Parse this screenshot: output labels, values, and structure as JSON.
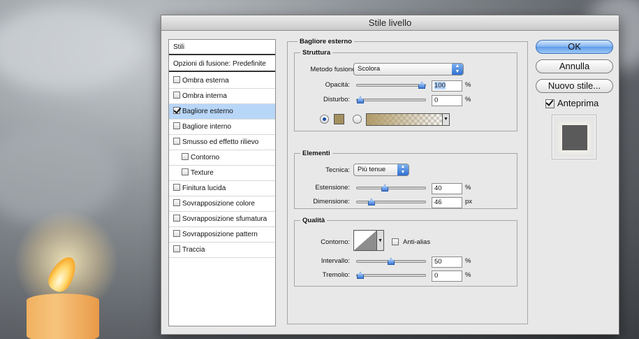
{
  "dialog": {
    "title": "Stile livello"
  },
  "styles_panel": {
    "header": "Stili",
    "blend_options": "Opzioni di fusione: Predefinite",
    "items": [
      {
        "label": "Ombra esterna",
        "checked": false,
        "indent": false,
        "selected": false
      },
      {
        "label": "Ombra interna",
        "checked": false,
        "indent": false,
        "selected": false
      },
      {
        "label": "Bagliore esterno",
        "checked": true,
        "indent": false,
        "selected": true
      },
      {
        "label": "Bagliore interno",
        "checked": false,
        "indent": false,
        "selected": false
      },
      {
        "label": "Smusso ed effetto rilievo",
        "checked": false,
        "indent": false,
        "selected": false
      },
      {
        "label": "Contorno",
        "checked": false,
        "indent": true,
        "selected": false
      },
      {
        "label": "Texture",
        "checked": false,
        "indent": true,
        "selected": false
      },
      {
        "label": "Finitura lucida",
        "checked": false,
        "indent": false,
        "selected": false
      },
      {
        "label": "Sovrapposizione colore",
        "checked": false,
        "indent": false,
        "selected": false
      },
      {
        "label": "Sovrapposizione sfumatura",
        "checked": false,
        "indent": false,
        "selected": false
      },
      {
        "label": "Sovrapposizione pattern",
        "checked": false,
        "indent": false,
        "selected": false
      },
      {
        "label": "Traccia",
        "checked": false,
        "indent": false,
        "selected": false
      }
    ]
  },
  "outer_glow": {
    "title": "Bagliore esterno",
    "structure": {
      "title": "Struttura",
      "blend_mode_label": "Metodo fusione:",
      "blend_mode_value": "Scolora",
      "opacity_label": "Opacità:",
      "opacity_value": "100",
      "opacity_unit": "%",
      "opacity_level": 1.0,
      "noise_label": "Disturbo:",
      "noise_value": "0",
      "noise_unit": "%",
      "noise_level": 0.0,
      "glow_color": "#a48f5e",
      "color_mode": "solid"
    },
    "elements": {
      "title": "Elementi",
      "technique_label": "Tecnica:",
      "technique_value": "Più tenue",
      "spread_label": "Estensione:",
      "spread_value": "40",
      "spread_unit": "%",
      "spread_level": 0.4,
      "size_label": "Dimensione:",
      "size_value": "46",
      "size_unit": "px",
      "size_level": 0.18
    },
    "quality": {
      "title": "Qualità",
      "contour_label": "Contorno:",
      "antialias_label": "Anti-alias",
      "antialias_checked": false,
      "range_label": "Intervallo:",
      "range_value": "50",
      "range_unit": "%",
      "range_level": 0.5,
      "jitter_label": "Tremolio:",
      "jitter_value": "0",
      "jitter_unit": "%",
      "jitter_level": 0.0
    }
  },
  "buttons": {
    "ok": "OK",
    "cancel": "Annulla",
    "new_style": "Nuovo stile...",
    "preview_label": "Anteprima",
    "preview_checked": true
  }
}
